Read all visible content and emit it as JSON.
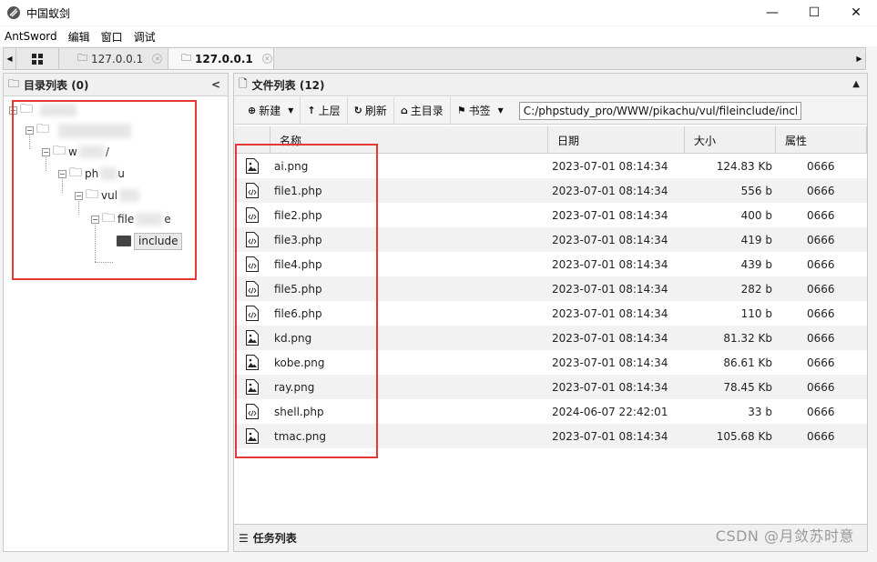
{
  "window": {
    "title": "中国蚁剑",
    "min": "—",
    "max": "☐",
    "close": "✕"
  },
  "menu": [
    "AntSword",
    "编辑",
    "窗口",
    "调试"
  ],
  "tabs": [
    {
      "label": "127.0.0.1"
    },
    {
      "label": "127.0.0.1"
    }
  ],
  "left_panel": {
    "title": "目录列表 (0)",
    "visible_node_fragments": [
      "w",
      "/",
      "ph",
      "u",
      "vul",
      "file",
      "e",
      "include"
    ],
    "selected_node": "include"
  },
  "right_panel": {
    "title": "文件列表 (12)",
    "toolbar": {
      "new": "新建",
      "up": "上层",
      "refresh": "刷新",
      "home": "主目录",
      "bookmark": "书签",
      "path": "C:/phpstudy_pro/WWW/pikachu/vul/fileinclude/include/"
    },
    "columns": [
      "名称",
      "日期",
      "大小",
      "属性"
    ],
    "files": [
      {
        "icon": "image",
        "name": "ai.png",
        "date": "2023-07-01 08:14:34",
        "size": "124.83 Kb",
        "perm": "0666"
      },
      {
        "icon": "code",
        "name": "file1.php",
        "date": "2023-07-01 08:14:34",
        "size": "556 b",
        "perm": "0666"
      },
      {
        "icon": "code",
        "name": "file2.php",
        "date": "2023-07-01 08:14:34",
        "size": "400 b",
        "perm": "0666"
      },
      {
        "icon": "code",
        "name": "file3.php",
        "date": "2023-07-01 08:14:34",
        "size": "419 b",
        "perm": "0666"
      },
      {
        "icon": "code",
        "name": "file4.php",
        "date": "2023-07-01 08:14:34",
        "size": "439 b",
        "perm": "0666"
      },
      {
        "icon": "code",
        "name": "file5.php",
        "date": "2023-07-01 08:14:34",
        "size": "282 b",
        "perm": "0666"
      },
      {
        "icon": "code",
        "name": "file6.php",
        "date": "2023-07-01 08:14:34",
        "size": "110 b",
        "perm": "0666"
      },
      {
        "icon": "image",
        "name": "kd.png",
        "date": "2023-07-01 08:14:34",
        "size": "81.32 Kb",
        "perm": "0666"
      },
      {
        "icon": "image",
        "name": "kobe.png",
        "date": "2023-07-01 08:14:34",
        "size": "86.61 Kb",
        "perm": "0666"
      },
      {
        "icon": "image",
        "name": "ray.png",
        "date": "2023-07-01 08:14:34",
        "size": "78.45 Kb",
        "perm": "0666"
      },
      {
        "icon": "code",
        "name": "shell.php",
        "date": "2024-06-07 22:42:01",
        "size": "33 b",
        "perm": "0666"
      },
      {
        "icon": "image",
        "name": "tmac.png",
        "date": "2023-07-01 08:14:34",
        "size": "105.68 Kb",
        "perm": "0666"
      }
    ]
  },
  "tasks_panel": {
    "title": "任务列表"
  },
  "watermark": "CSDN @月敛苏时意",
  "colors": {
    "highlight": "#e53935",
    "row_alt": "#f2f2f2"
  }
}
